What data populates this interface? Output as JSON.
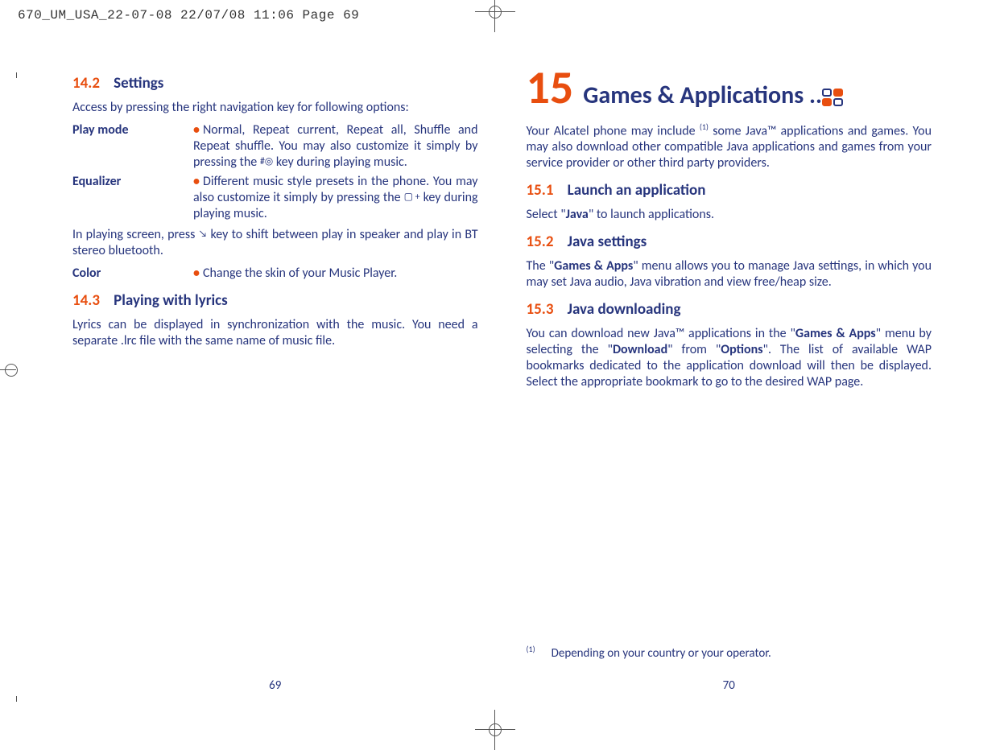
{
  "meta": {
    "header": "670_UM_USA_22-07-08  22/07/08  11:06  Page 69"
  },
  "left": {
    "s142_num": "14.2",
    "s142_title": "Settings",
    "s142_intro": "Access by pressing the right navigation key for following options:",
    "playmode_label": "Play mode",
    "playmode_text_a": "Normal, Repeat current, Repeat all, Shuffle and Repeat shuffle. You may also customize it simply by pressing the ",
    "playmode_text_b": " key during playing music.",
    "equalizer_label": "Equalizer",
    "equalizer_text_a": "Different music style presets in the phone. You may also customize it simply by pressing the ",
    "equalizer_text_b": " key during playing music.",
    "inplay_a": "In playing screen, press ",
    "inplay_b": " key to shift between play in speaker and play in BT stereo bluetooth.",
    "color_label": "Color",
    "color_text": "Change the skin of your Music Player.",
    "s143_num": "14.3",
    "s143_title": "Playing with lyrics",
    "s143_text": "Lyrics can be displayed in synchronization with the music. You need a separate .lrc file with the same name of music file.",
    "pagenum": "69"
  },
  "right": {
    "chapter_num": "15",
    "chapter_title": "Games & Applications ..",
    "intro_a": "Your Alcatel phone may include ",
    "intro_sup": "(1)",
    "intro_b": " some Java™ applications and games. You may also download other compatible Java applications and games from your service provider or other third party providers.",
    "s151_num": "15.1",
    "s151_title": "Launch an application",
    "s151_text_a": "Select \"",
    "s151_text_bold": "Java",
    "s151_text_b": "\" to launch applications.",
    "s152_num": "15.2",
    "s152_title": "Java settings",
    "s152_text_a": "The \"",
    "s152_bold1": "Games & Apps",
    "s152_text_b": "\" menu allows you to manage Java settings, in which you may set Java audio, Java vibration and view free/heap size.",
    "s153_num": "15.3",
    "s153_title": "Java downloading",
    "s153_text_a": "You can download new Java™ applications in the \"",
    "s153_bold1": "Games & Apps",
    "s153_text_b": "\" menu by selecting the \"",
    "s153_bold2": "Download",
    "s153_text_c": "\" from \"",
    "s153_bold3": "Options",
    "s153_text_d": "\". The list of available WAP bookmarks dedicated to the application download will then be displayed. Select the appropriate bookmark to go to the desired WAP page.",
    "footnote_sup": "(1)",
    "footnote_text": "Depending on your country or your operator.",
    "pagenum": "70"
  }
}
